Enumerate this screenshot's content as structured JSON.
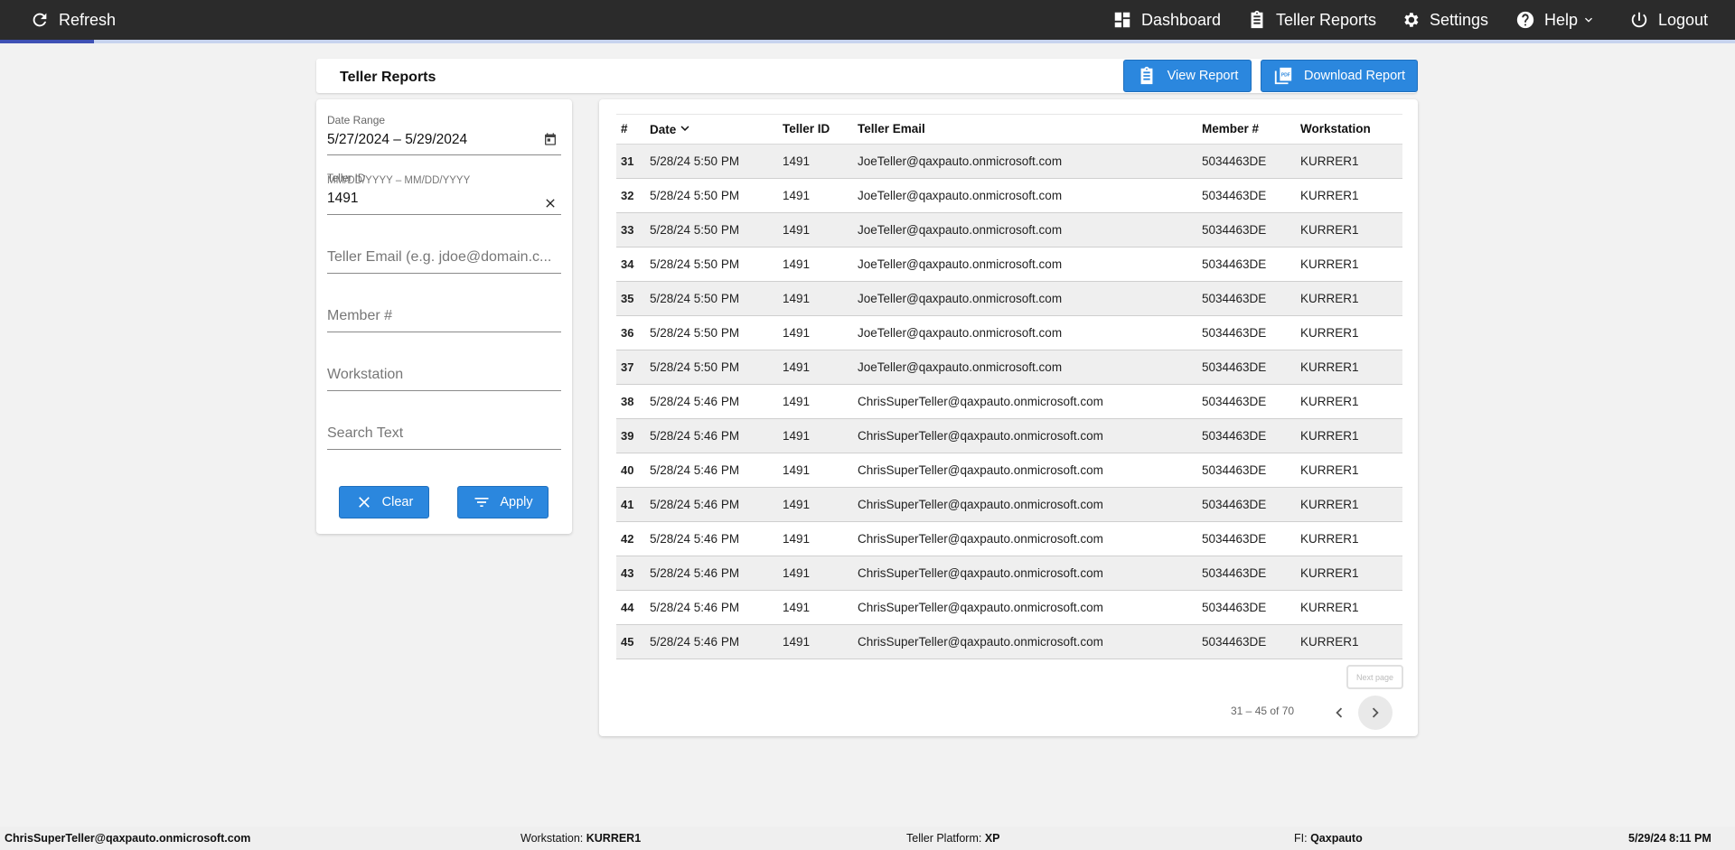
{
  "nav": {
    "refresh": "Refresh",
    "dashboard": "Dashboard",
    "teller_reports": "Teller Reports",
    "settings": "Settings",
    "help": "Help",
    "logout": "Logout",
    "progress_fraction": 0.054
  },
  "header": {
    "title": "Teller Reports",
    "view_report": "View Report",
    "download_report": "Download Report",
    "pdf_icon_text": "PDF"
  },
  "filters": {
    "date_range_label": "Date Range",
    "date_range_value": "5/27/2024 – 5/29/2024",
    "date_range_hint": "MM/DD/YYYY – MM/DD/YYYY",
    "teller_id_label": "Teller ID",
    "teller_id_value": "1491",
    "teller_email_placeholder": "Teller Email (e.g. jdoe@domain.c...",
    "member_placeholder": "Member #",
    "workstation_placeholder": "Workstation",
    "search_placeholder": "Search Text",
    "clear_label": "Clear",
    "apply_label": "Apply"
  },
  "table": {
    "columns": [
      "#",
      "Date",
      "Teller ID",
      "Teller Email",
      "Member #",
      "Workstation"
    ],
    "rows": [
      [
        "31",
        "5/28/24 5:50 PM",
        "1491",
        "JoeTeller@qaxpauto.onmicrosoft.com",
        "5034463DE",
        "KURRER1"
      ],
      [
        "32",
        "5/28/24 5:50 PM",
        "1491",
        "JoeTeller@qaxpauto.onmicrosoft.com",
        "5034463DE",
        "KURRER1"
      ],
      [
        "33",
        "5/28/24 5:50 PM",
        "1491",
        "JoeTeller@qaxpauto.onmicrosoft.com",
        "5034463DE",
        "KURRER1"
      ],
      [
        "34",
        "5/28/24 5:50 PM",
        "1491",
        "JoeTeller@qaxpauto.onmicrosoft.com",
        "5034463DE",
        "KURRER1"
      ],
      [
        "35",
        "5/28/24 5:50 PM",
        "1491",
        "JoeTeller@qaxpauto.onmicrosoft.com",
        "5034463DE",
        "KURRER1"
      ],
      [
        "36",
        "5/28/24 5:50 PM",
        "1491",
        "JoeTeller@qaxpauto.onmicrosoft.com",
        "5034463DE",
        "KURRER1"
      ],
      [
        "37",
        "5/28/24 5:50 PM",
        "1491",
        "JoeTeller@qaxpauto.onmicrosoft.com",
        "5034463DE",
        "KURRER1"
      ],
      [
        "38",
        "5/28/24 5:46 PM",
        "1491",
        "ChrisSuperTeller@qaxpauto.onmicrosoft.com",
        "5034463DE",
        "KURRER1"
      ],
      [
        "39",
        "5/28/24 5:46 PM",
        "1491",
        "ChrisSuperTeller@qaxpauto.onmicrosoft.com",
        "5034463DE",
        "KURRER1"
      ],
      [
        "40",
        "5/28/24 5:46 PM",
        "1491",
        "ChrisSuperTeller@qaxpauto.onmicrosoft.com",
        "5034463DE",
        "KURRER1"
      ],
      [
        "41",
        "5/28/24 5:46 PM",
        "1491",
        "ChrisSuperTeller@qaxpauto.onmicrosoft.com",
        "5034463DE",
        "KURRER1"
      ],
      [
        "42",
        "5/28/24 5:46 PM",
        "1491",
        "ChrisSuperTeller@qaxpauto.onmicrosoft.com",
        "5034463DE",
        "KURRER1"
      ],
      [
        "43",
        "5/28/24 5:46 PM",
        "1491",
        "ChrisSuperTeller@qaxpauto.onmicrosoft.com",
        "5034463DE",
        "KURRER1"
      ],
      [
        "44",
        "5/28/24 5:46 PM",
        "1491",
        "ChrisSuperTeller@qaxpauto.onmicrosoft.com",
        "5034463DE",
        "KURRER1"
      ],
      [
        "45",
        "5/28/24 5:46 PM",
        "1491",
        "ChrisSuperTeller@qaxpauto.onmicrosoft.com",
        "5034463DE",
        "KURRER1"
      ]
    ]
  },
  "pagination": {
    "next_tooltip": "Next page",
    "range": "31 – 45 of 70"
  },
  "footer": {
    "user": "ChrisSuperTeller@qaxpauto.onmicrosoft.com",
    "workstation_label": "Workstation:",
    "workstation_value": "KURRER1",
    "platform_label": "Teller Platform:",
    "platform_value": "XP",
    "fi_label": "FI:",
    "fi_value": "Qaxpauto",
    "datetime": "5/29/24 8:11 PM"
  },
  "colors": {
    "topbar": "#2b2b2b",
    "accent_blue": "#2b87de",
    "progress": "#3f51b5"
  }
}
